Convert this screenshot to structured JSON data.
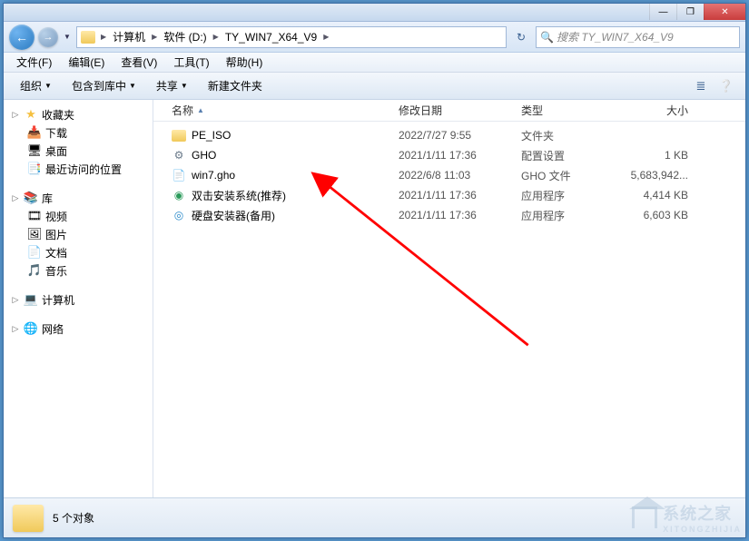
{
  "titlebar": {
    "min": "—",
    "max": "❐",
    "close": "✕"
  },
  "nav": {
    "back": "←",
    "fwd": "→",
    "drop": "▼",
    "refresh": "↻"
  },
  "breadcrumb": {
    "segs": [
      "计算机",
      "软件 (D:)",
      "TY_WIN7_X64_V9"
    ],
    "tri": "▶"
  },
  "search": {
    "placeholder": "搜索 TY_WIN7_X64_V9",
    "icon": "🔍"
  },
  "menubar": [
    "文件(F)",
    "编辑(E)",
    "查看(V)",
    "工具(T)",
    "帮助(H)"
  ],
  "toolbar": {
    "organize": "组织",
    "include": "包含到库中",
    "share": "共享",
    "newfolder": "新建文件夹",
    "tri": "▼",
    "view_icon": "≣",
    "help_icon": "❔"
  },
  "columns": {
    "name": "名称",
    "date": "修改日期",
    "type": "类型",
    "size": "大小",
    "sort": "▲"
  },
  "files": [
    {
      "icon": "folder",
      "name": "PE_ISO",
      "date": "2022/7/27 9:55",
      "type": "文件夹",
      "size": ""
    },
    {
      "icon": "cfg",
      "glyph": "⚙",
      "name": "GHO",
      "date": "2021/1/11 17:36",
      "type": "配置设置",
      "size": "1 KB"
    },
    {
      "icon": "gho",
      "glyph": "📄",
      "name": "win7.gho",
      "date": "2022/6/8 11:03",
      "type": "GHO 文件",
      "size": "5,683,942..."
    },
    {
      "icon": "exe1",
      "glyph": "◉",
      "name": "双击安装系统(推荐)",
      "date": "2021/1/11 17:36",
      "type": "应用程序",
      "size": "4,414 KB"
    },
    {
      "icon": "exe2",
      "glyph": "◎",
      "name": "硬盘安装器(备用)",
      "date": "2021/1/11 17:36",
      "type": "应用程序",
      "size": "6,603 KB"
    }
  ],
  "sidebar": {
    "fav": "收藏夹",
    "fav_items": [
      "下载",
      "桌面",
      "最近访问的位置"
    ],
    "lib": "库",
    "lib_items": [
      "视频",
      "图片",
      "文档",
      "音乐"
    ],
    "computer": "计算机",
    "network": "网络"
  },
  "status": {
    "count": "5 个对象"
  },
  "watermark": {
    "main": "系统之家",
    "sub": "XITONGZHIJIA"
  }
}
